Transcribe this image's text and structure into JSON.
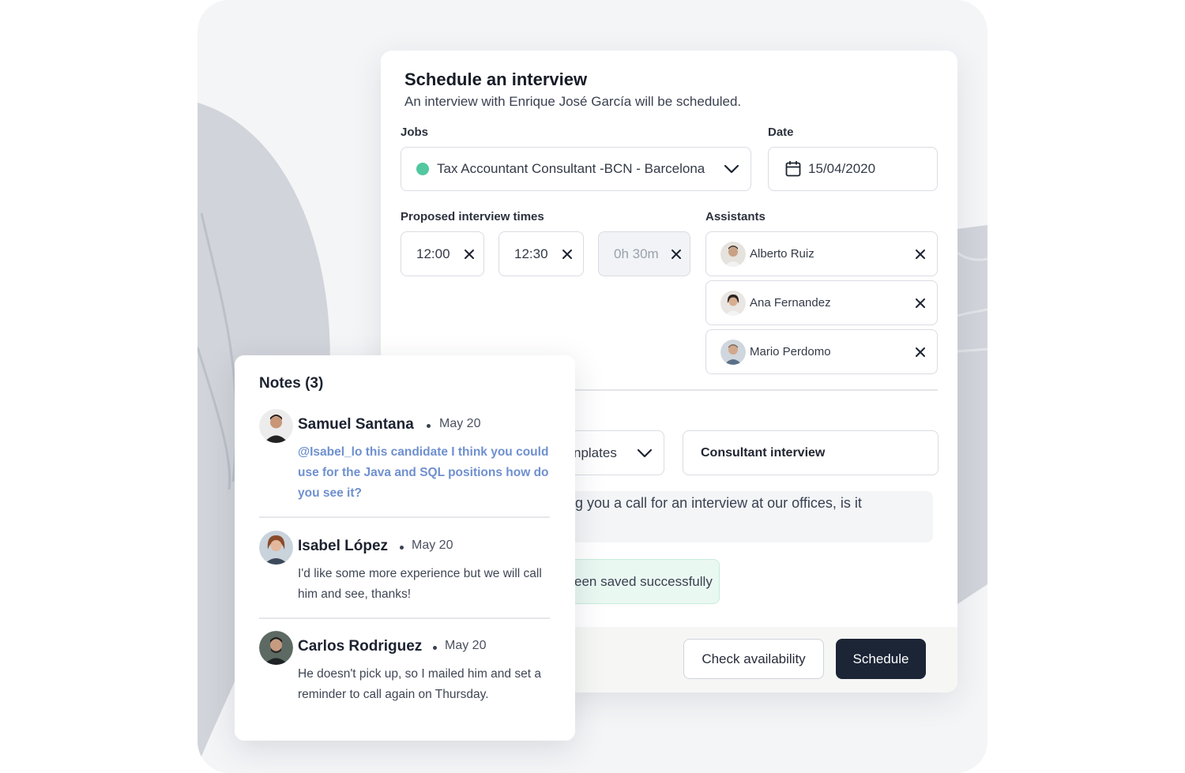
{
  "modal": {
    "title": "Schedule an interview",
    "subtitle": "An interview with Enrique José García will be scheduled.",
    "jobs_label": "Jobs",
    "job_value": "Tax Accountant Consultant -BCN - Barcelona",
    "date_label": "Date",
    "date_value": "15/04/2020",
    "times_label": "Proposed interview times",
    "times": [
      "12:00",
      "12:30"
    ],
    "duration": "0h 30m",
    "assistants_label": "Assistants",
    "assistants": [
      "Alberto Ruiz",
      "Ana Fernandez",
      "Mario Perdomo"
    ],
    "template_select": "nplates",
    "template_name": "Consultant interview",
    "message_text": "g you a call for an interview at our offices, is it",
    "toast_text": "een saved successfully",
    "check_availability": "Check availability",
    "schedule": "Schedule"
  },
  "notes": {
    "title": "Notes (3)",
    "items": [
      {
        "author": "Samuel Santana",
        "date": "May 20",
        "text": "@Isabel_lo this candidate I think you could use for the Java and SQL positions how do you see it?"
      },
      {
        "author": "Isabel López",
        "date": "May 20",
        "text": "I'd like some more experience but we will call him and see, thanks!"
      },
      {
        "author": "Carlos Rodriguez",
        "date": "May 20",
        "text": "He doesn't pick up, so I mailed him and set a reminder to call again on Thursday."
      }
    ]
  },
  "colors": {
    "primary_button": "#1c2536",
    "job_status_dot": "#52c7a0",
    "mention": "#6f90cf",
    "toast_bg": "#eaf8f2"
  },
  "icons": [
    "chevron-down-icon",
    "calendar-icon",
    "close-icon",
    "avatar"
  ]
}
